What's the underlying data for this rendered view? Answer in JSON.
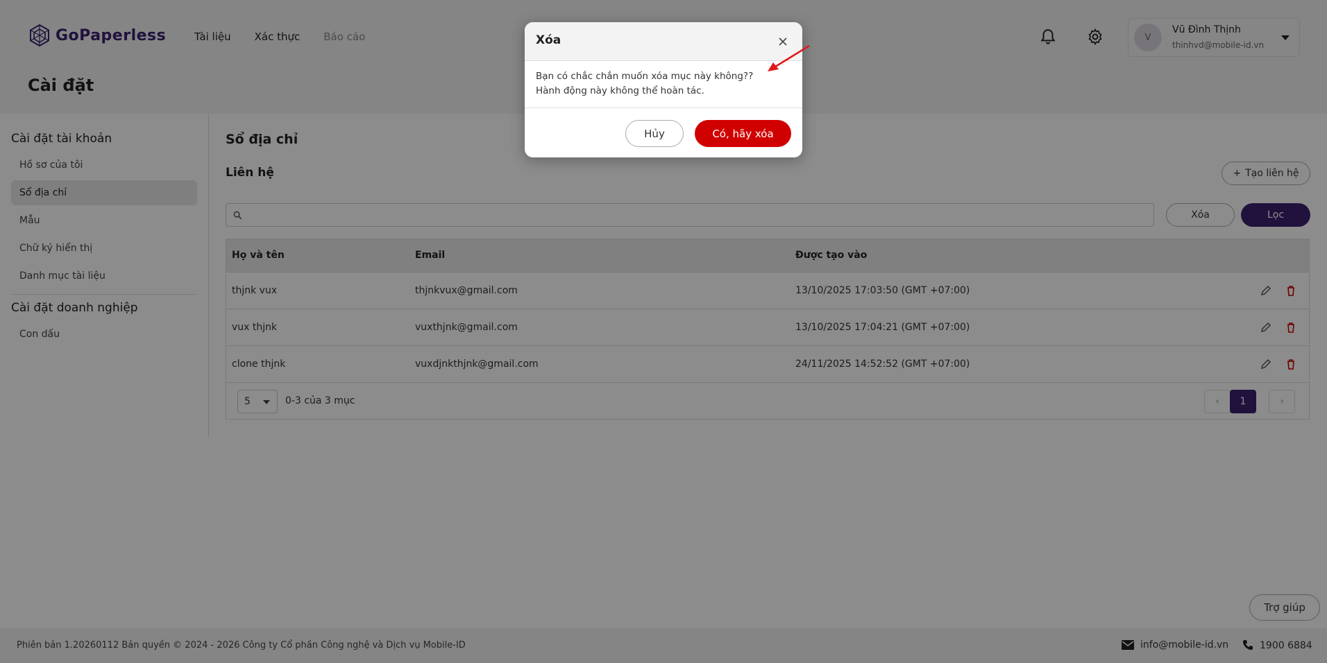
{
  "brand": {
    "name": "GoPaperless",
    "accent": "#3b2170",
    "danger": "#d10000"
  },
  "nav": [
    {
      "label": "Tài liệu",
      "enabled": true
    },
    {
      "label": "Xác thực",
      "enabled": true
    },
    {
      "label": "Báo cáo",
      "enabled": false
    }
  ],
  "header_icons": [
    "bell-icon",
    "gear-icon"
  ],
  "user": {
    "initial": "V",
    "name": "Vũ Đình Thịnh",
    "email": "thinhvd@mobile-id.vn"
  },
  "page": {
    "title": "Cài đặt"
  },
  "sidebar": {
    "account_group": "Cài đặt tài khoản",
    "account_items": [
      {
        "label": "Hồ sơ của tôi",
        "active": false
      },
      {
        "label": "Sổ địa chỉ",
        "active": true
      },
      {
        "label": "Mẫu",
        "active": false
      },
      {
        "label": "Chữ ký hiển thị",
        "active": false
      },
      {
        "label": "Danh mục tài liệu",
        "active": false
      }
    ],
    "enterprise_group": "Cài đặt doanh nghiệp",
    "enterprise_items": [
      {
        "label": "Con dấu",
        "active": false
      }
    ]
  },
  "main": {
    "title": "Sổ địa chỉ",
    "section": "Liên hệ",
    "create_button": "Tạo liên hệ",
    "search": {
      "value": "",
      "placeholder": ""
    },
    "clear_button": "Xóa",
    "filter_button": "Lọc"
  },
  "table": {
    "columns": [
      "Họ và tên",
      "Email",
      "Được tạo vào"
    ],
    "rows": [
      {
        "name": "thjnk vux",
        "email": "thjnkvux@gmail.com",
        "created": "13/10/2025 17:03:50 (GMT +07:00)"
      },
      {
        "name": "vux thjnk",
        "email": "vuxthjnk@gmail.com",
        "created": "13/10/2025 17:04:21 (GMT +07:00)"
      },
      {
        "name": "clone thjnk",
        "email": "vuxdjnkthjnk@gmail.com",
        "created": "24/11/2025 14:52:52 (GMT +07:00)"
      }
    ],
    "page_size": "5",
    "page_info": "0-3 của 3 mục",
    "current_page": "1",
    "prev_symbol": "‹",
    "next_symbol": "›"
  },
  "help_button": "Trợ giúp",
  "footer": {
    "text": "Phiên bản 1.20260112 Bản quyền © 2024 - 2026 Công ty Cổ phần Công nghệ và Dịch vụ Mobile-ID",
    "email": "info@mobile-id.vn",
    "phone": "1900 6884"
  },
  "modal": {
    "title": "Xóa",
    "line1": "Bạn có chắc chắn muốn xóa mục này không??",
    "line2": "Hành động này không thể hoàn tác.",
    "cancel": "Hủy",
    "confirm": "Có, hãy xóa"
  }
}
